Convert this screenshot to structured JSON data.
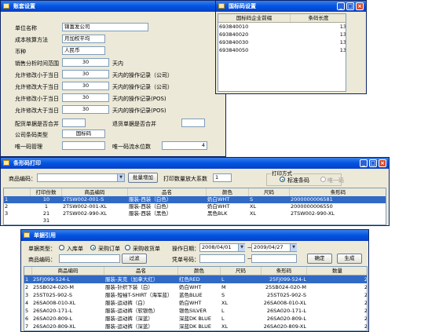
{
  "settings": {
    "title": "账套设置",
    "fields": [
      {
        "label": "单位名称",
        "value": "锦富发公司"
      },
      {
        "label": "成本核算方法",
        "value": "月加权平均"
      },
      {
        "label": "币种",
        "value": "人民币"
      },
      {
        "label": "销售分析时间范围",
        "value": "30",
        "suffix": "天内"
      },
      {
        "label": "允许修改小于当日",
        "value": "30",
        "suffix": "天内的操作记录（公司）"
      },
      {
        "label": "允许修改大于当日",
        "value": "30",
        "suffix": "天内的操作记录（公司）"
      },
      {
        "label": "允许修改小于当日",
        "value": "30",
        "suffix": "天内的操作记录(POS)"
      },
      {
        "label": "允许修改大于当日",
        "value": "30",
        "suffix": "天内的操作记录(POS)"
      }
    ],
    "merge_label": "配货单据是否合并",
    "return_merge_label": "退货单据是否合并",
    "company_type_label": "公司条码类型",
    "company_type_value": "国标码",
    "unique_code_label": "唯一码管理",
    "digits_label": "唯一码流水位数",
    "digits_value": "4"
  },
  "barcode_win": {
    "title": "国标码设置",
    "headers": [
      "国标码企业前缀",
      "条码长度"
    ],
    "rows": [
      {
        "prefix": "693840010",
        "len": "13"
      },
      {
        "prefix": "693840020",
        "len": "13"
      },
      {
        "prefix": "693840030",
        "len": "13"
      },
      {
        "prefix": "693840050",
        "len": "13"
      }
    ]
  },
  "print_win": {
    "title": "条形码打印",
    "product_code_label": "商品编码：",
    "batch_add": "批量增加",
    "print_factor_label": "打印数量放大系数",
    "print_factor_value": "1",
    "print_mode_label": "打印方式",
    "mode_standard": "标准条码",
    "mode_unique": "唯一码",
    "headers": [
      "打印份数",
      "商品编码",
      "品名",
      "颜色",
      "尺码",
      "条形码"
    ],
    "rows": [
      {
        "no": "1",
        "copies": "10",
        "code": "2TSW002-001-S",
        "name": "服装-西装（白色）",
        "color": "奶白WHT",
        "size": "S",
        "barcode": "2000000006581"
      },
      {
        "no": "2",
        "copies": "1",
        "code": "2TSW002-001-XL",
        "name": "服装-西装（白色）",
        "color": "奶白WHT",
        "size": "XL",
        "barcode": "2000000006550"
      },
      {
        "no": "3",
        "copies": "21",
        "code": "2TSW002-990-XL",
        "name": "服装-西装（黑色）",
        "color": "黑色BLK",
        "size": "XL",
        "barcode": "2TSW002-990-XL"
      },
      {
        "no": "",
        "copies": "31",
        "code": "",
        "name": "",
        "color": "",
        "size": "",
        "barcode": ""
      }
    ]
  },
  "ref_win": {
    "title": "单据引用",
    "doc_type_label": "单据类型：",
    "opt_inbound": "入库单",
    "opt_purchase_order": "采购订单",
    "opt_purchase_receipt": "采购收货单",
    "date_label": "操作日期：",
    "date_from": "2008/04/01",
    "date_to": "2009/04/27",
    "product_code_label": "商品编码：",
    "filter_btn": "过滤",
    "voucher_label": "凭单号码：",
    "ok_btn": "确定",
    "gen_btn": "生成",
    "headers": [
      "商品编码",
      "品名",
      "颜色",
      "尺码",
      "条形码",
      "数量"
    ],
    "rows": [
      {
        "no": "1",
        "code": "25FJ099-524-L",
        "name": "服装-夹克（加拿大红）",
        "color": "红色RED",
        "size": "L",
        "barcode": "25FJ099-524-L",
        "qty": "2"
      },
      {
        "no": "2",
        "code": "25SB024-020-M",
        "name": "服装-针织下装（白）",
        "color": "奶白WHT",
        "size": "M",
        "barcode": "25SB024-020-M",
        "qty": "2"
      },
      {
        "no": "3",
        "code": "25ST025-902-S",
        "name": "服装-短袖T-SHIRT（海军蓝）",
        "color": "蓝色BLUE",
        "size": "S",
        "barcode": "25ST025-902-S",
        "qty": "2"
      },
      {
        "no": "4",
        "code": "26SA008-010-XL",
        "name": "服装-运动裤（白）",
        "color": "奶白WHT",
        "size": "XL",
        "barcode": "26SA008-010-XL",
        "qty": "2"
      },
      {
        "no": "5",
        "code": "26SA020-171-L",
        "name": "服装-运动裤（软银色）",
        "color": "银色SILVER",
        "size": "L",
        "barcode": "26SA020-171-L",
        "qty": "2"
      },
      {
        "no": "6",
        "code": "26SA020-809-L",
        "name": "服装-运动裤（深蓝）",
        "color": "深蓝DK BLUE",
        "size": "L",
        "barcode": "26SA020-809-L",
        "qty": "2"
      },
      {
        "no": "7",
        "code": "26SA020-809-XL",
        "name": "服装-运动裤（深蓝）",
        "color": "深蓝DK BLUE",
        "size": "XL",
        "barcode": "26SA020-809-XL",
        "qty": "2"
      }
    ]
  }
}
